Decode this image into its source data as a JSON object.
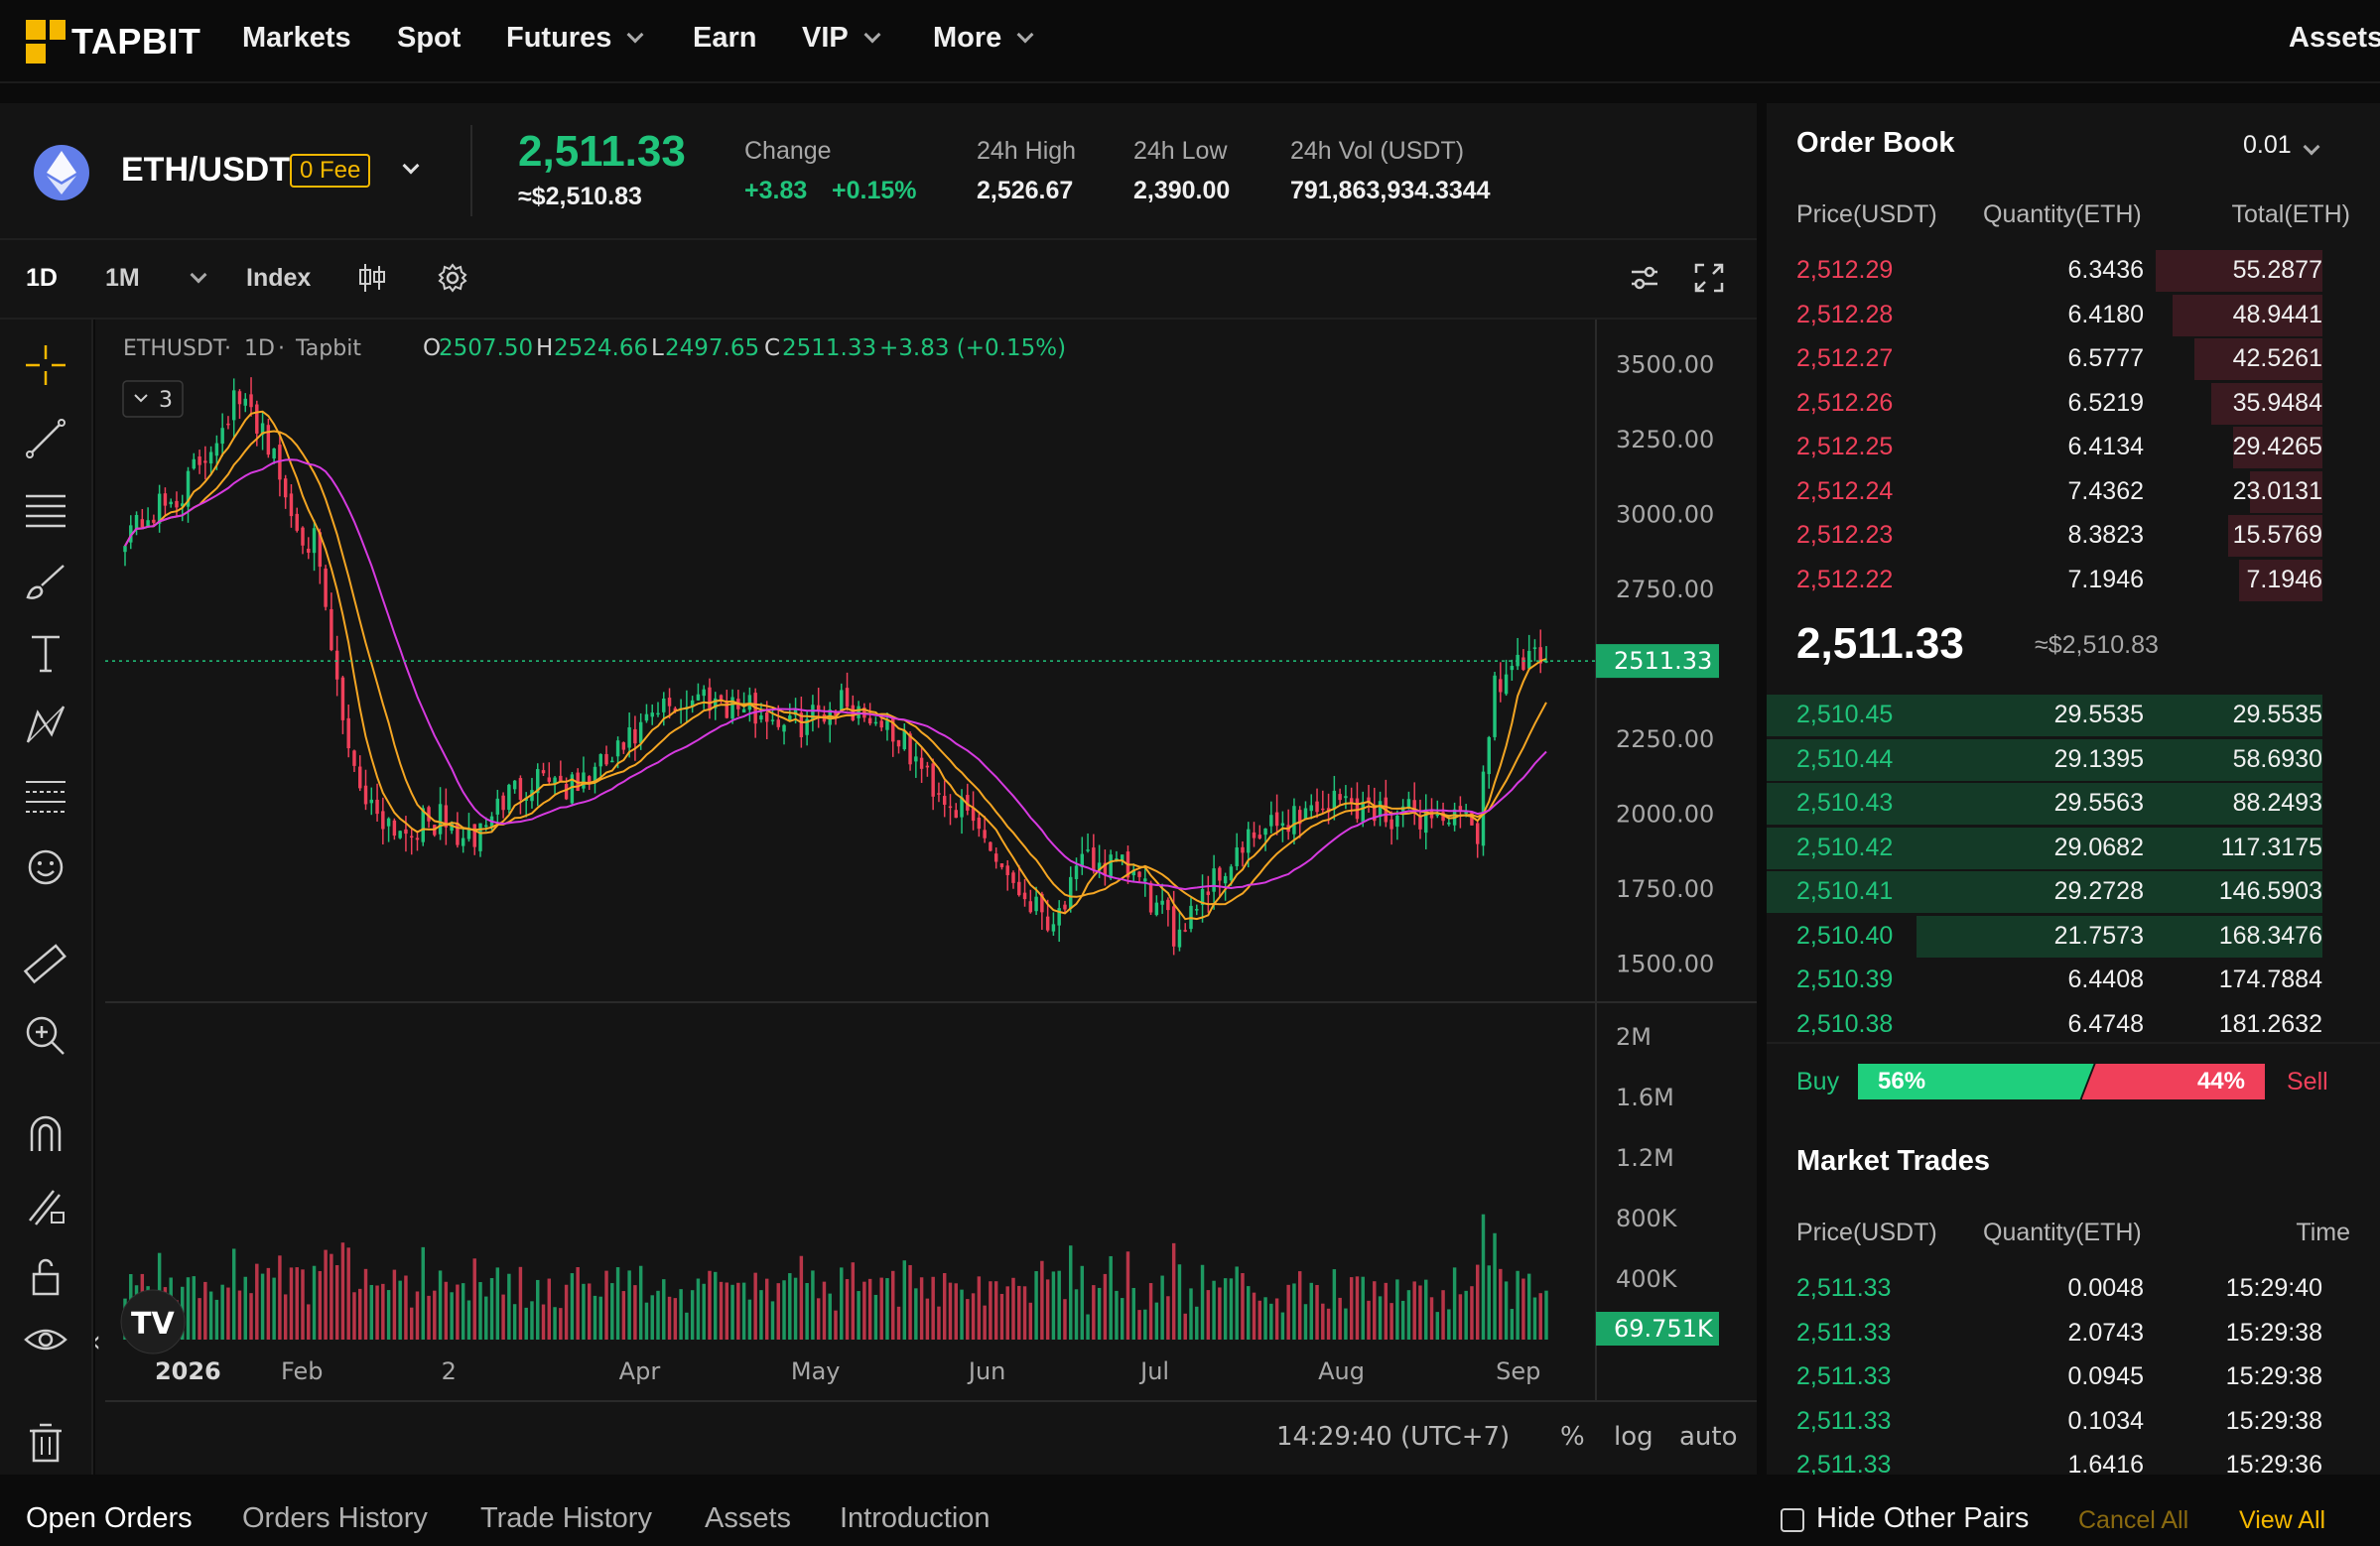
{
  "nav": {
    "logo": "TAPBIT",
    "items": [
      {
        "label": "Markets"
      },
      {
        "label": "Spot"
      },
      {
        "label": "Futures"
      },
      {
        "label": "Earn"
      },
      {
        "label": "VIP"
      },
      {
        "label": "More"
      }
    ],
    "right": "Assets"
  },
  "ticker": {
    "pair": "ETH/USDT",
    "fee_badge": "0 Fee",
    "last_price": "2,511.33",
    "last_usd": "≈$2,510.83",
    "change_label": "Change",
    "change_abs": "+3.83",
    "change_pct": "+0.15%",
    "high_label": "24h High",
    "high": "2,526.67",
    "low_label": "24h Low",
    "low": "2,390.00",
    "vol_label": "24h Vol (USDT)",
    "vol": "791,863,934.3344"
  },
  "chart_toolbar": {
    "intervals": [
      "1D",
      "1M"
    ],
    "index_label": "Index"
  },
  "chart": {
    "symbol": "ETHUSDT",
    "interval": "1D",
    "exchange": "Tapbit",
    "dot": "·",
    "ohlc": {
      "O": "2507.50",
      "H": "2524.66",
      "L": "2497.65",
      "C": "2511.33",
      "change": "+3.83 (+0.15%)"
    },
    "indicator_count": "3",
    "price_label": "2511.33",
    "volume_label": "69.751K",
    "timezone": "14:29:40 (UTC+7)",
    "scale_buttons": [
      "%",
      "log",
      "auto"
    ],
    "colors": {
      "up": "#20c47b",
      "down": "#f0405a",
      "ma_fast": "#f5a623",
      "ma_mid": "#f5a623",
      "ma_slow": "#d63ae0"
    }
  },
  "chart_data": {
    "type": "candlestick",
    "y_ticks": [
      3500,
      3250,
      3000,
      2750,
      2500,
      2250,
      2000,
      1750,
      1500
    ],
    "y_tick_labels": [
      "3500.00",
      "3250.00",
      "3000.00",
      "2750.00",
      "",
      "2250.00",
      "2000.00",
      "1750.00",
      "1500.00"
    ],
    "ylim": [
      1380,
      3650
    ],
    "volume_ticks": [
      "2M",
      "1.6M",
      "1.2M",
      "800K",
      "400K"
    ],
    "volume_ylim": [
      0,
      2100000
    ],
    "x_tick_labels": [
      "2026",
      "Feb",
      "2",
      "Apr",
      "May",
      "Jun",
      "Jul",
      "Aug",
      "Sep"
    ],
    "close_anchors": [
      [
        "2026-01-01",
        2950
      ],
      [
        "2026-01-10",
        3050
      ],
      [
        "2026-01-15",
        3200
      ],
      [
        "2026-01-20",
        3380
      ],
      [
        "2026-01-25",
        3300
      ],
      [
        "2026-01-30",
        3000
      ],
      [
        "2026-02-03",
        2900
      ],
      [
        "2026-02-08",
        2300
      ],
      [
        "2026-02-12",
        2050
      ],
      [
        "2026-02-18",
        1950
      ],
      [
        "2026-02-25",
        1980
      ],
      [
        "2026-03-02",
        1900
      ],
      [
        "2026-03-08",
        2050
      ],
      [
        "2026-03-15",
        2150
      ],
      [
        "2026-03-20",
        2080
      ],
      [
        "2026-03-28",
        2200
      ],
      [
        "2026-04-05",
        2350
      ],
      [
        "2026-04-12",
        2400
      ],
      [
        "2026-04-20",
        2350
      ],
      [
        "2026-04-28",
        2300
      ],
      [
        "2026-05-06",
        2380
      ],
      [
        "2026-05-14",
        2300
      ],
      [
        "2026-05-22",
        2100
      ],
      [
        "2026-05-30",
        1950
      ],
      [
        "2026-06-06",
        1750
      ],
      [
        "2026-06-12",
        1650
      ],
      [
        "2026-06-18",
        1850
      ],
      [
        "2026-06-26",
        1800
      ],
      [
        "2026-07-03",
        1600
      ],
      [
        "2026-07-08",
        1750
      ],
      [
        "2026-07-16",
        1900
      ],
      [
        "2026-07-24",
        2000
      ],
      [
        "2026-08-01",
        2050
      ],
      [
        "2026-08-10",
        2000
      ],
      [
        "2026-08-18",
        2000
      ],
      [
        "2026-08-25",
        1950
      ],
      [
        "2026-08-28",
        2450
      ],
      [
        "2026-09-02",
        2500
      ],
      [
        "2026-09-06",
        2511.33
      ]
    ]
  },
  "orderbook": {
    "title": "Order Book",
    "precision": "0.01",
    "headers": [
      "Price(USDT)",
      "Quantity(ETH)",
      "Total(ETH)"
    ],
    "asks": [
      {
        "price": "2,512.29",
        "qty": "6.3436",
        "total": "55.2877",
        "depth": 0.3
      },
      {
        "price": "2,512.28",
        "qty": "6.4180",
        "total": "48.9441",
        "depth": 0.27
      },
      {
        "price": "2,512.27",
        "qty": "6.5777",
        "total": "42.5261",
        "depth": 0.23
      },
      {
        "price": "2,512.26",
        "qty": "6.5219",
        "total": "35.9484",
        "depth": 0.2
      },
      {
        "price": "2,512.25",
        "qty": "6.4134",
        "total": "29.4265",
        "depth": 0.16
      },
      {
        "price": "2,512.24",
        "qty": "7.4362",
        "total": "23.0131",
        "depth": 0.13
      },
      {
        "price": "2,512.23",
        "qty": "8.3823",
        "total": "15.5769",
        "depth": 0.17
      },
      {
        "price": "2,512.22",
        "qty": "7.1946",
        "total": "7.1946",
        "depth": 0.15
      }
    ],
    "mid_price": "2,511.33",
    "mid_usd": "≈$2,510.83",
    "bids": [
      {
        "price": "2,510.45",
        "qty": "29.5535",
        "total": "29.5535",
        "depth": 1.0
      },
      {
        "price": "2,510.44",
        "qty": "29.1395",
        "total": "58.6930",
        "depth": 1.0
      },
      {
        "price": "2,510.43",
        "qty": "29.5563",
        "total": "88.2493",
        "depth": 1.0
      },
      {
        "price": "2,510.42",
        "qty": "29.0682",
        "total": "117.3175",
        "depth": 1.0
      },
      {
        "price": "2,510.41",
        "qty": "29.2728",
        "total": "146.5903",
        "depth": 1.0
      },
      {
        "price": "2,510.40",
        "qty": "21.7573",
        "total": "168.3476",
        "depth": 0.73
      },
      {
        "price": "2,510.39",
        "qty": "6.4408",
        "total": "174.7884",
        "depth": 0
      },
      {
        "price": "2,510.38",
        "qty": "6.4748",
        "total": "181.2632",
        "depth": 0
      }
    ],
    "buy_label": "Buy",
    "buy_pct": "56%",
    "sell_pct": "44%",
    "sell_label": "Sell",
    "buy_ratio": 0.56
  },
  "market_trades": {
    "title": "Market Trades",
    "headers": [
      "Price(USDT)",
      "Quantity(ETH)",
      "Time"
    ],
    "rows": [
      {
        "price": "2,511.33",
        "qty": "0.0048",
        "time": "15:29:40"
      },
      {
        "price": "2,511.33",
        "qty": "2.0743",
        "time": "15:29:38"
      },
      {
        "price": "2,511.33",
        "qty": "0.0945",
        "time": "15:29:38"
      },
      {
        "price": "2,511.33",
        "qty": "0.1034",
        "time": "15:29:38"
      },
      {
        "price": "2,511.33",
        "qty": "1.6416",
        "time": "15:29:36"
      }
    ]
  },
  "bottom_tabs": {
    "tabs": [
      "Open Orders",
      "Orders History",
      "Trade History",
      "Assets",
      "Introduction"
    ],
    "hide_pairs": "Hide Other Pairs",
    "cancel_all": "Cancel All",
    "view_all": "View All"
  }
}
